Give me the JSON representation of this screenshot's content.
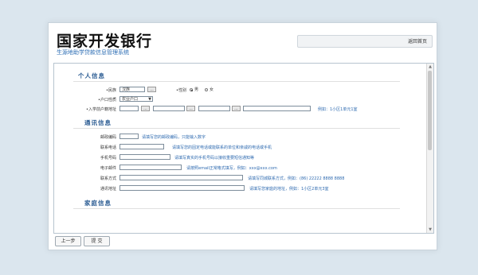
{
  "brand": {
    "title": "国家开发银行",
    "subtitle": "生源地助学贷款信息管理系统"
  },
  "header": {
    "link": "返回首页"
  },
  "sections": {
    "personal": "个人信息",
    "contact": "通讯信息",
    "family": "家庭信息"
  },
  "personal": {
    "ethnicity_label": "•民族",
    "ethnicity_value": "汉族",
    "gender_label": "•性别",
    "gender_options": [
      "男",
      "女"
    ],
    "hukou_label": "•户口性质",
    "hukou_value": "农业户口",
    "address_label": "•入学前户籍地址",
    "address_hint": "例如：1小区1单元1室"
  },
  "contact": {
    "postcode_label": "邮政编码",
    "postcode_hint": "请填写您的邮政编码，只能输入数字",
    "phone_label": "联系电话",
    "phone_hint": "请填写您的固定电话或能联系的单位和亲戚的电话或手机",
    "mobile_label": "手机号码",
    "mobile_hint": "请填写真实的手机号码以接收重要短信通知等",
    "email_label": "电子邮件",
    "email_hint": "请按照email正常格式填写，例如：xxx@xxx.com",
    "family_contact_label": "联系方式",
    "family_contact_hint": "请填写同城联系方式，例如：(86) 22222 8888 8888",
    "mail_address_label": "通讯地址",
    "mail_address_hint": "请填写您家庭的地址，例如：1小区2单元3室"
  },
  "buttons": {
    "prev": "上一步",
    "submit": "提 交",
    "browse": "...",
    "select_arrow": "▼",
    "scroll_up": "▲",
    "scroll_down": "▼"
  }
}
